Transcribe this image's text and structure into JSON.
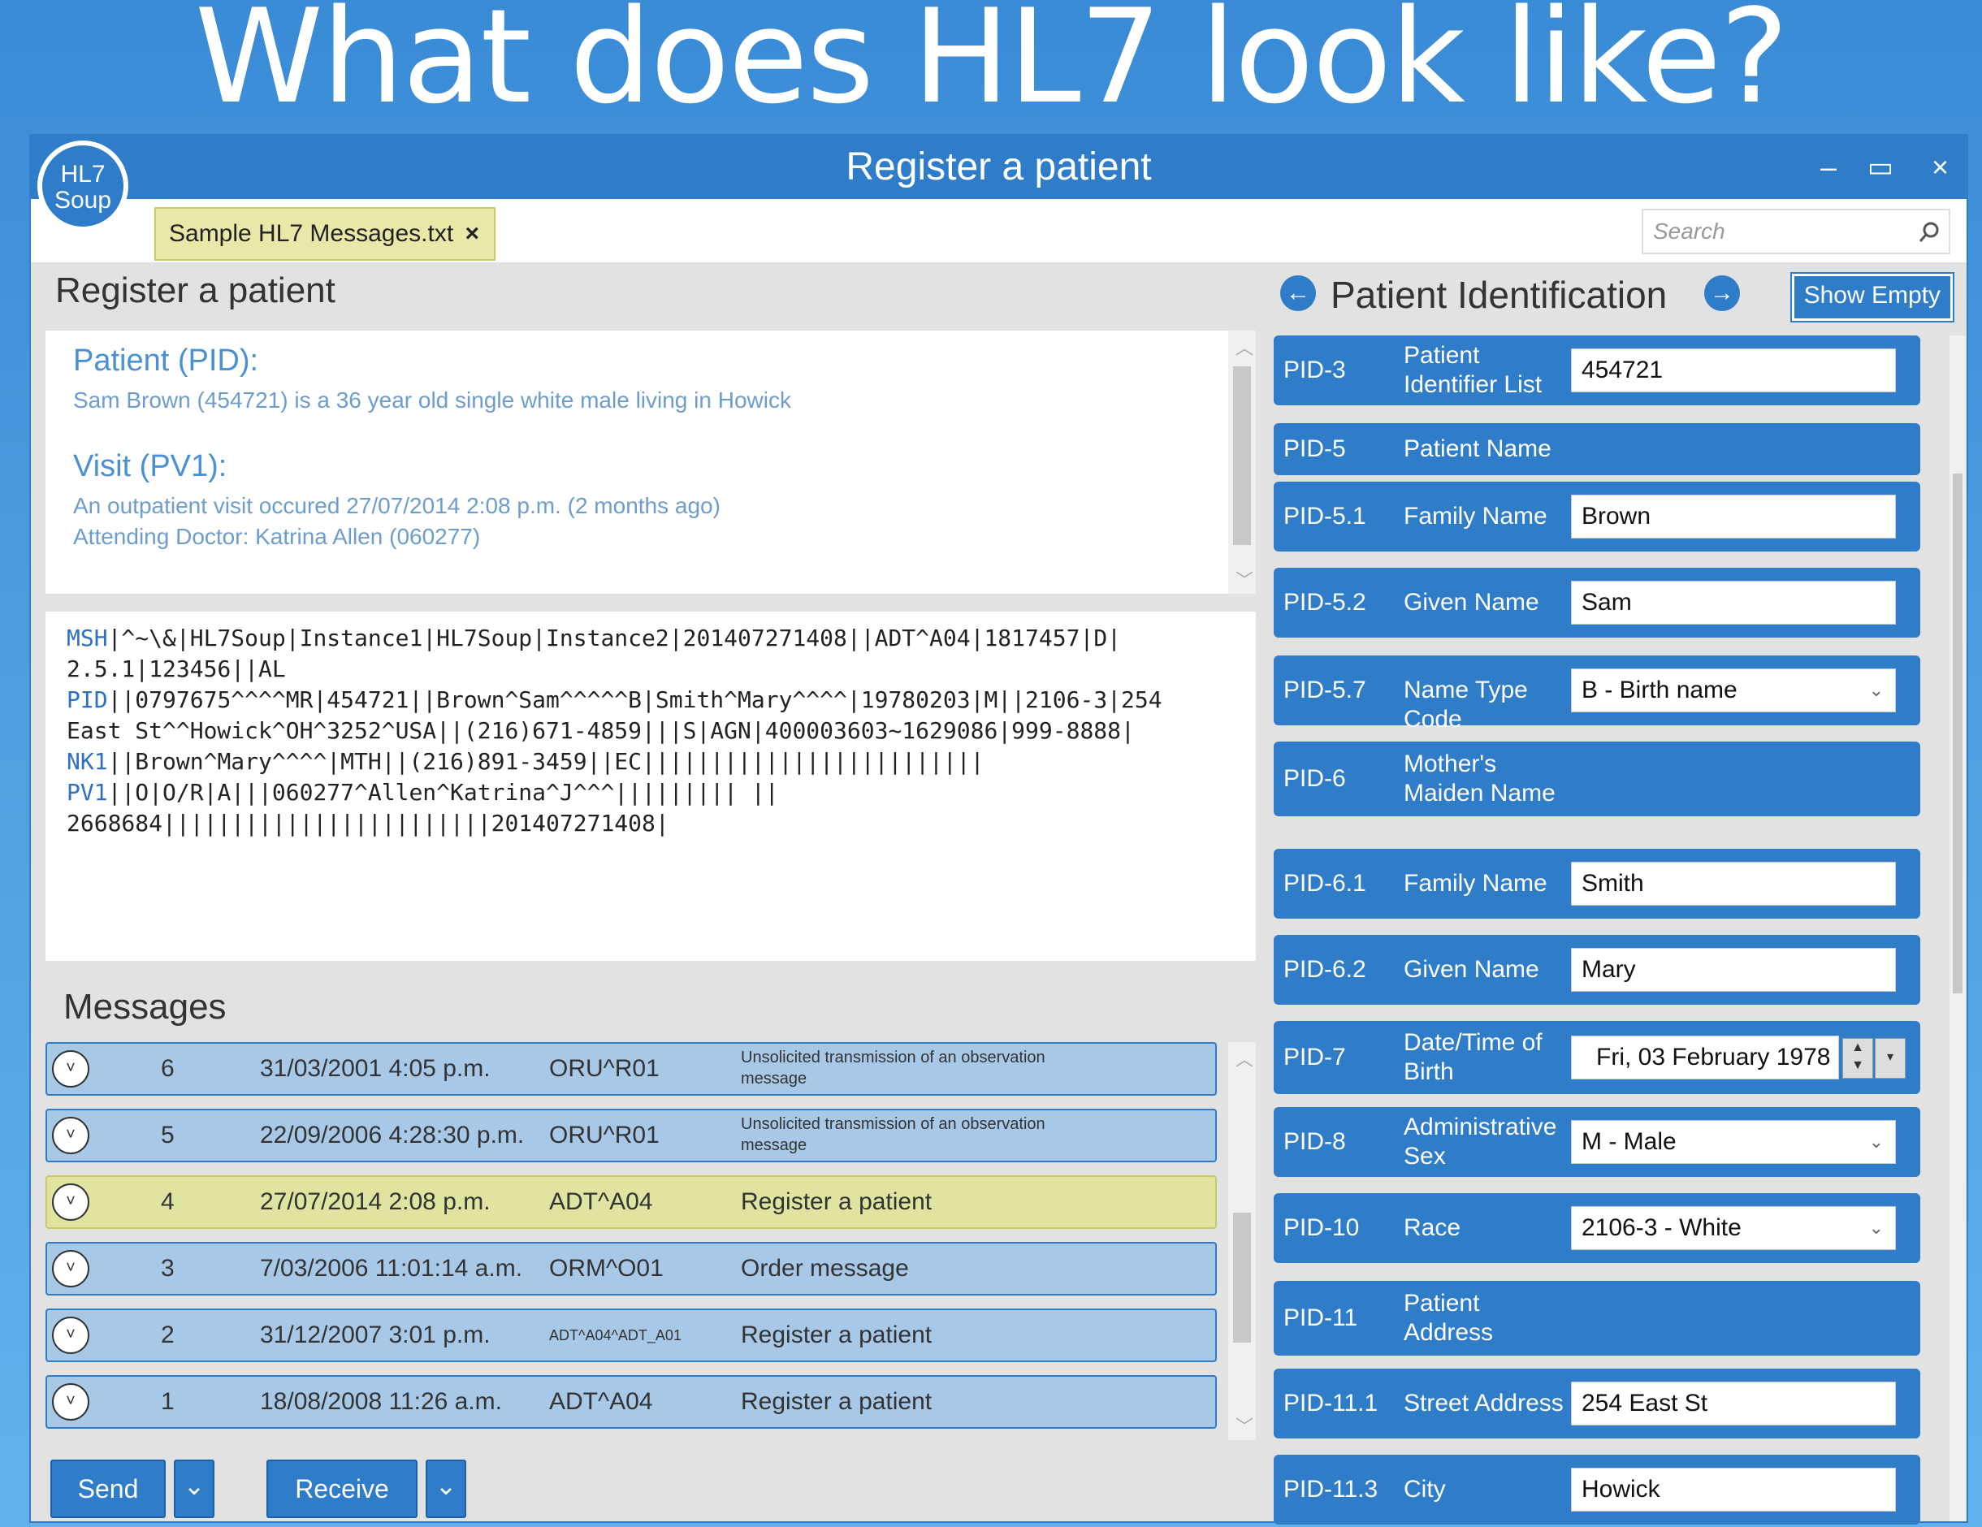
{
  "slide": {
    "title": "What does HL7 look like?"
  },
  "window": {
    "title": "Register a patient",
    "logo_line1": "HL7",
    "logo_line2": "Soup",
    "minimize": "–",
    "maximize": "▭",
    "close": "×"
  },
  "tab": {
    "label": "Sample HL7 Messages.txt",
    "close": "×"
  },
  "search": {
    "placeholder": "Search",
    "icon": "search-icon"
  },
  "left": {
    "heading": "Register a patient",
    "summary": {
      "patient_heading": "Patient (PID):",
      "patient_text": "Sam Brown (454721) is a 36 year old single white male living in Howick",
      "visit_heading": "Visit (PV1):",
      "visit_text1": "An outpatient visit occured 27/07/2014 2:08 p.m. (2 months ago)",
      "visit_text2": "Attending Doctor: Katrina Allen (060277)"
    },
    "raw_message": [
      {
        "seg": "MSH",
        "rest": "|^~\\&|HL7Soup|Instance1|HL7Soup|Instance2|201407271408||ADT^A04|1817457|D|"
      },
      {
        "seg": "",
        "rest": "2.5.1|123456||AL"
      },
      {
        "seg": "PID",
        "rest": "||0797675^^^^MR|454721||Brown^Sam^^^^^B|Smith^Mary^^^^|19780203|M||2106-3|254"
      },
      {
        "seg": "",
        "rest": "East St^^Howick^OH^3252^USA||(216)671-4859|||S|AGN|400003603~1629086|999-8888|"
      },
      {
        "seg": "NK1",
        "rest": "||Brown^Mary^^^^|MTH||(216)891-3459||EC|||||||||||||||||||||||||"
      },
      {
        "seg": "PV1",
        "rest": "||O|O/R|A|||060277^Allen^Katrina^J^^^||||||||| ||"
      },
      {
        "seg": "",
        "rest": "2668684||||||||||||||||||||||||201407271408|"
      }
    ],
    "messages_heading": "Messages",
    "messages": [
      {
        "num": "6",
        "date": "31/03/2001 4:05 p.m.",
        "type": "ORU^R01",
        "desc": "Unsolicited transmission of an observation message",
        "small": true
      },
      {
        "num": "5",
        "date": "22/09/2006 4:28:30 p.m.",
        "type": "ORU^R01",
        "desc": "Unsolicited transmission of an observation message",
        "small": true
      },
      {
        "num": "4",
        "date": "27/07/2014 2:08 p.m.",
        "type": "ADT^A04",
        "desc": "Register a patient",
        "small": false
      },
      {
        "num": "3",
        "date": "7/03/2006 11:01:14 a.m.",
        "type": "ORM^O01",
        "desc": "Order message",
        "small": false
      },
      {
        "num": "2",
        "date": "31/12/2007 3:01 p.m.",
        "type": "ADT^A04^ADT_A01",
        "desc": "Register a patient",
        "small": false
      },
      {
        "num": "1",
        "date": "18/08/2008 11:26 a.m.",
        "type": "ADT^A04",
        "desc": "Register a patient",
        "small": false
      }
    ],
    "send_label": "Send",
    "receive_label": "Receive",
    "dropdown_glyph": "⌄"
  },
  "right": {
    "title": "Patient Identification",
    "show_empty": "Show Empty",
    "fields": [
      {
        "id": "PID-3",
        "name": "Patient Identifier List",
        "value": "454721"
      },
      {
        "id": "PID-5",
        "name": "Patient Name",
        "value": ""
      },
      {
        "id": "PID-5.1",
        "name": "Family Name",
        "value": "Brown"
      },
      {
        "id": "PID-5.2",
        "name": "Given Name",
        "value": "Sam"
      },
      {
        "id": "PID-5.7",
        "name": "Name Type Code",
        "value": "B - Birth name"
      },
      {
        "id": "PID-6",
        "name": "Mother's Maiden Name",
        "value": ""
      },
      {
        "id": "PID-6.1",
        "name": "Family Name",
        "value": "Smith"
      },
      {
        "id": "PID-6.2",
        "name": "Given Name",
        "value": "Mary"
      },
      {
        "id": "PID-7",
        "name": "Date/Time of Birth",
        "value": "Fri, 03 February 1978"
      },
      {
        "id": "PID-8",
        "name": "Administrative Sex",
        "value": "M - Male"
      },
      {
        "id": "PID-10",
        "name": "Race",
        "value": "2106-3 - White"
      },
      {
        "id": "PID-11",
        "name": "Patient Address",
        "value": ""
      },
      {
        "id": "PID-11.1",
        "name": "Street Address",
        "value": "254 East St"
      },
      {
        "id": "PID-11.3",
        "name": "City",
        "value": "Howick"
      }
    ]
  },
  "colors": {
    "accent": "#2f7cc9",
    "selected_row": "#e0e4a0",
    "message_row": "#a8c8e8",
    "segment": "#2f6fc2"
  }
}
